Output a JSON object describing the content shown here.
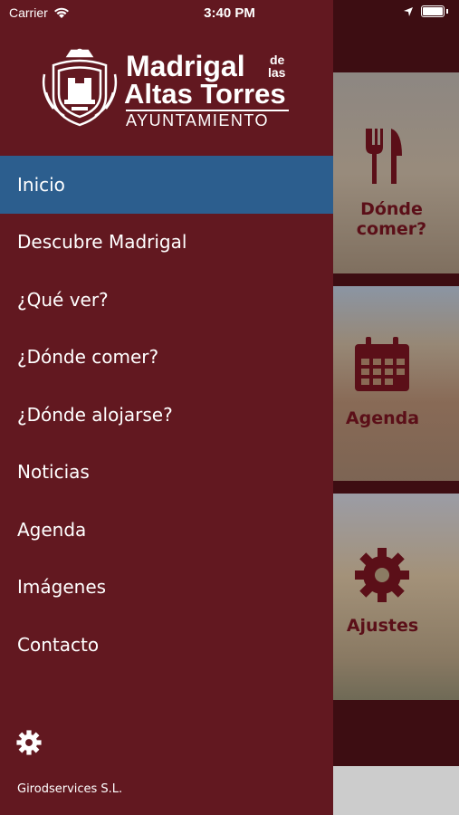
{
  "status_bar": {
    "carrier": "Carrier",
    "time": "3:40 PM"
  },
  "logo": {
    "line1": "Madrigal",
    "line1_suffix_top": "de",
    "line1_suffix_bottom": "las",
    "line2": "Altas Torres",
    "line3": "AYUNTAMIENTO"
  },
  "menu": {
    "items": [
      {
        "label": "Inicio",
        "active": true
      },
      {
        "label": "Descubre Madrigal"
      },
      {
        "label": "¿Qué ver?"
      },
      {
        "label": "¿Dónde comer?"
      },
      {
        "label": "¿Dónde alojarse?"
      },
      {
        "label": "Noticias"
      },
      {
        "label": "Agenda"
      },
      {
        "label": "Imágenes"
      },
      {
        "label": "Contacto"
      }
    ]
  },
  "footer": {
    "settings_icon": "gear-icon",
    "company": "Girodservices S.L."
  },
  "background_tiles": [
    {
      "label": "Dónde comer?",
      "icon": "fork-knife-icon"
    },
    {
      "label": "Agenda",
      "icon": "calendar-icon"
    },
    {
      "label": "Ajustes",
      "icon": "gear-icon"
    }
  ],
  "colors": {
    "drawer": "#621820",
    "active_item": "#2c5e8e",
    "tile_label": "#5b0f18"
  }
}
